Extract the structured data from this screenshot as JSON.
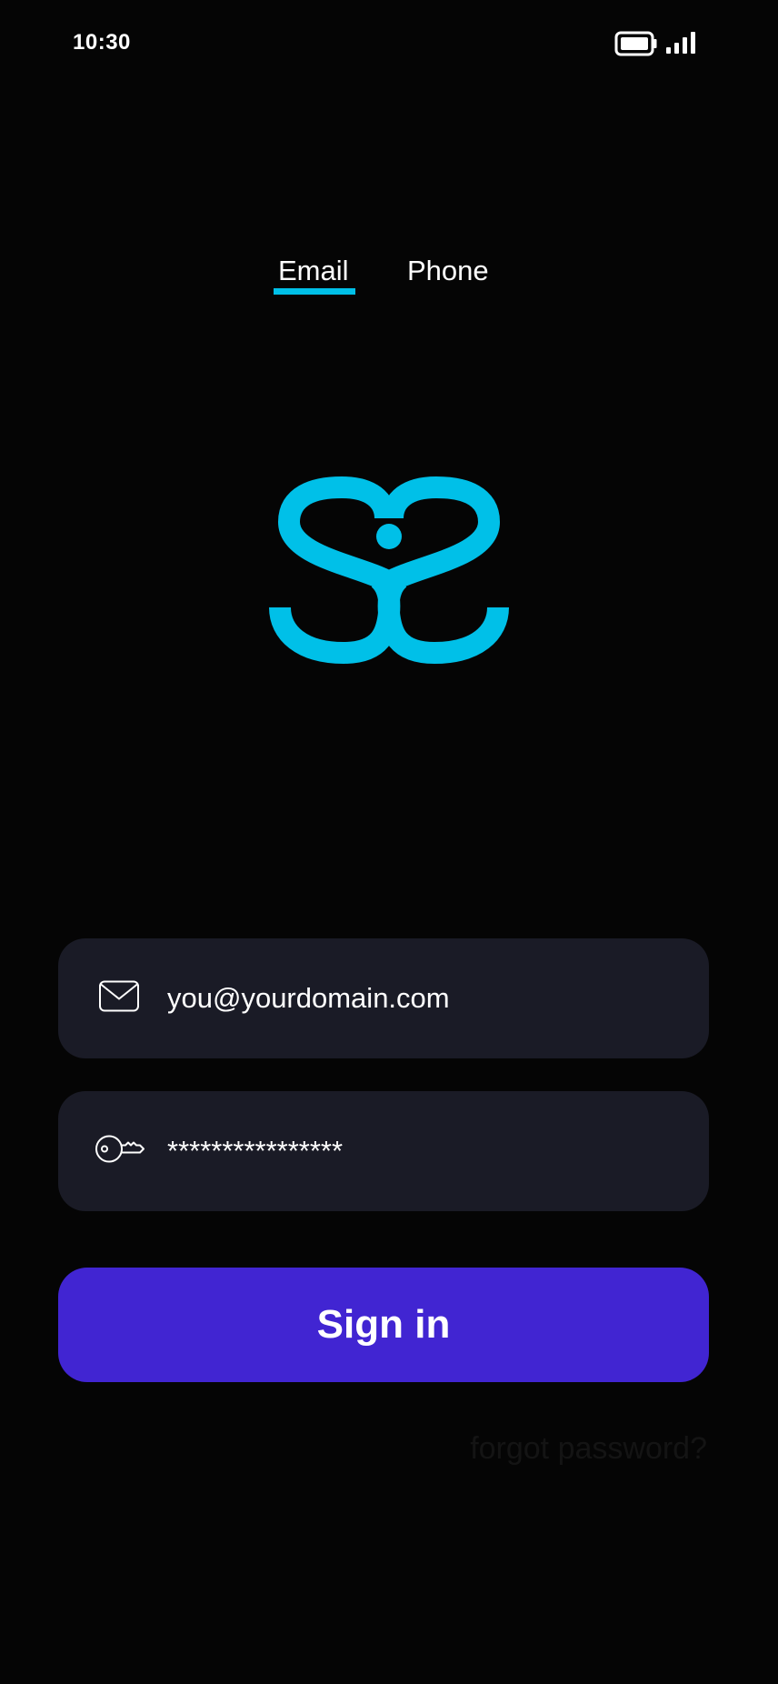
{
  "status_bar": {
    "time": "10:30",
    "battery_icon": "battery-icon",
    "signal_icon": "signal-icon"
  },
  "tabs": [
    {
      "label": "Email",
      "active": true
    },
    {
      "label": "Phone",
      "active": false
    }
  ],
  "logo": {
    "icon": "brand-logo-icon",
    "color": "#00c0e8"
  },
  "email_field": {
    "icon": "envelope-icon",
    "value": "you@yourdomain.com"
  },
  "password_field": {
    "icon": "key-icon",
    "value": "****************"
  },
  "signin_button": {
    "label": "Sign in",
    "color": "#4125d2"
  },
  "forgot_link": {
    "label": "forgot password?"
  },
  "colors": {
    "background": "#050505",
    "field_background": "#1a1b26",
    "accent": "#00c0e8"
  }
}
